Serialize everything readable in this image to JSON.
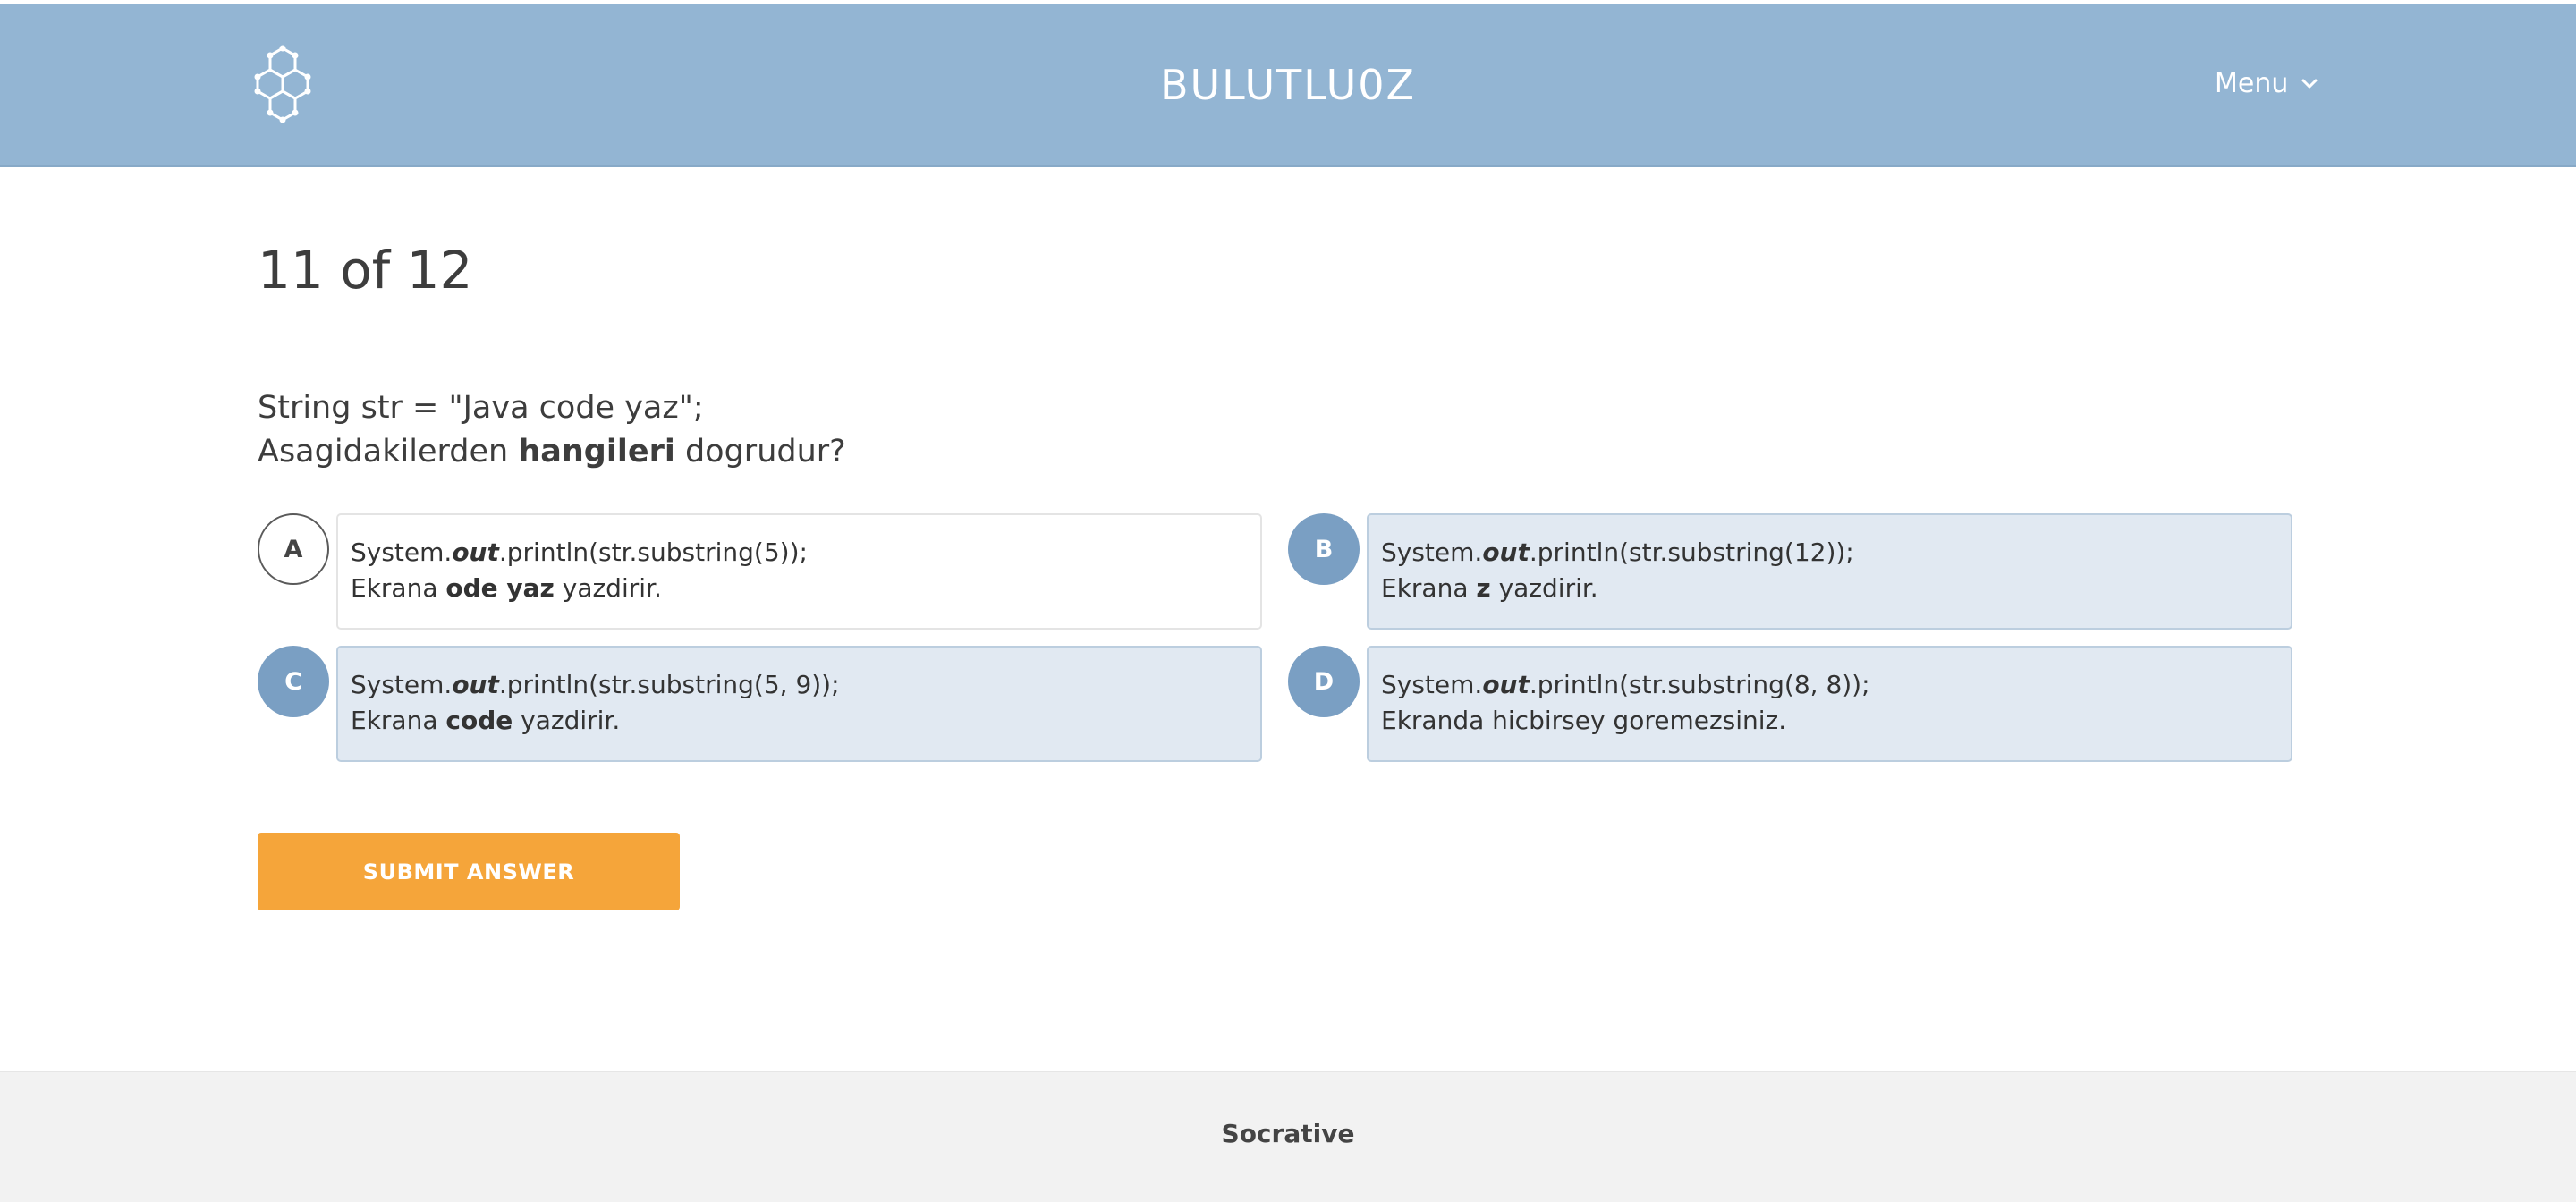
{
  "header": {
    "brand": "BULUTLU0Z",
    "menu_label": "Menu",
    "logo_icon": "hexagon-cluster-icon",
    "menu_icon": "chevron-down-icon",
    "background_color": "#93b5d3"
  },
  "progress": {
    "text": "11 of 12"
  },
  "question": {
    "line1": "String str = \"Java code yaz\";",
    "line2_pre": "Asagidakilerden ",
    "line2_bold": "hangileri",
    "line2_post": " dogrudur?"
  },
  "answers": [
    {
      "letter": "A",
      "code_pre": "System.",
      "code_kw": "out",
      "code_post": ".println(str.substring(5));",
      "desc_pre": "Ekrana ",
      "desc_bold": "ode yaz",
      "desc_post": " yazdirir."
    },
    {
      "letter": "B",
      "code_pre": "System.",
      "code_kw": "out",
      "code_post": ".println(str.substring(12));",
      "desc_pre": "Ekrana ",
      "desc_bold": "z",
      "desc_post": " yazdirir."
    },
    {
      "letter": "C",
      "code_pre": "System.",
      "code_kw": "out",
      "code_post": ".println(str.substring(5, 9));",
      "desc_pre": "Ekrana ",
      "desc_bold": "code",
      "desc_post": " yazdirir."
    },
    {
      "letter": "D",
      "code_pre": "System.",
      "code_kw": "out",
      "code_post": ".println(str.substring(8, 8));",
      "desc_pre": "Ekranda hicbirsey goremezsiniz.",
      "desc_bold": "",
      "desc_post": ""
    }
  ],
  "submit": {
    "label": "SUBMIT ANSWER",
    "color": "#f5a53a"
  },
  "footer": {
    "credit": "Socrative"
  }
}
